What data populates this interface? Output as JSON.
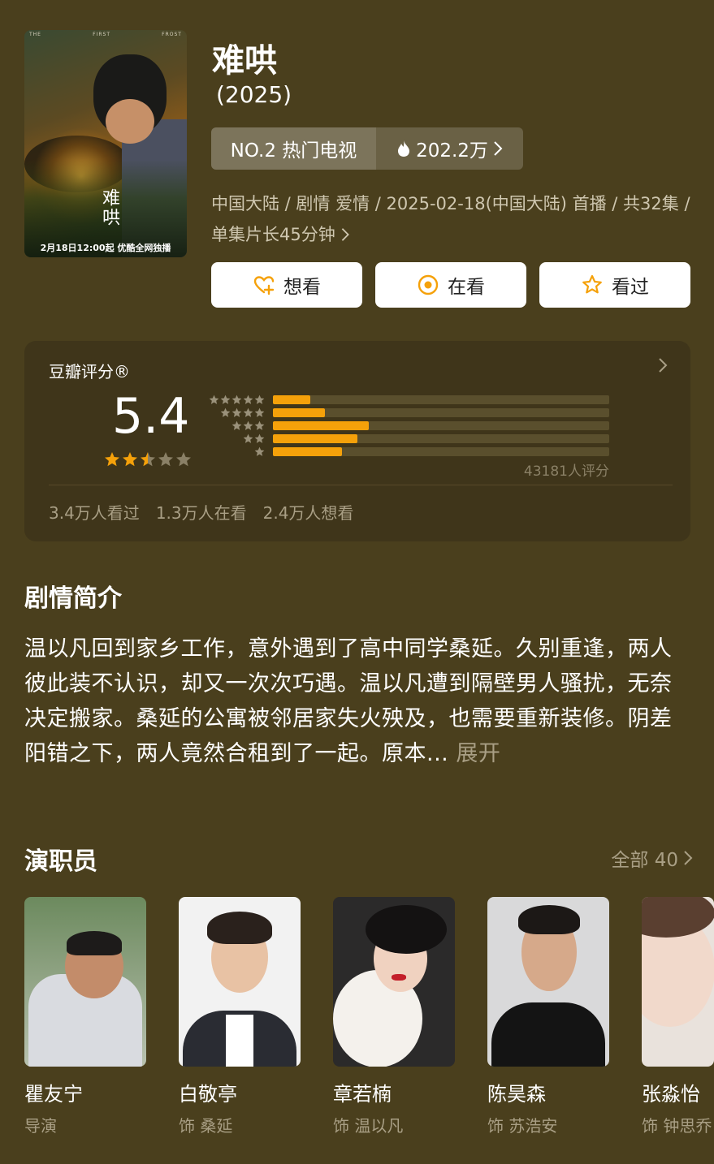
{
  "show": {
    "title": "难哄",
    "year": "(2025)",
    "rank_label": "NO.2 热门电视",
    "heat": "202.2万",
    "meta": "中国大陆 / 剧情 爱情 / 2025-02-18(中国大陆) 首播 / 共32集 / 单集片长45分钟",
    "poster": {
      "title": "难哄",
      "caption": "2月18日12:00起 优酷全网独播",
      "top_left": "THE",
      "top_mid": "FIRST",
      "top_right": "FROST"
    }
  },
  "actions": [
    {
      "label": "想看",
      "icon": "heart-plus-icon"
    },
    {
      "label": "在看",
      "icon": "target-icon"
    },
    {
      "label": "看过",
      "icon": "star-outline-icon"
    }
  ],
  "rating": {
    "label": "豆瓣评分®",
    "score": "5.4",
    "stars": 2.5,
    "distribution": [
      {
        "stars": 5,
        "fraction": 0.11
      },
      {
        "stars": 4,
        "fraction": 0.155
      },
      {
        "stars": 3,
        "fraction": 0.285
      },
      {
        "stars": 2,
        "fraction": 0.25
      },
      {
        "stars": 1,
        "fraction": 0.205
      }
    ],
    "votes": "43181人评分",
    "watched": "3.4万人看过",
    "watching": "1.3万人在看",
    "want": "2.4万人想看",
    "colors": {
      "accent": "#f5a10a",
      "muted": "#8a8066"
    }
  },
  "synopsis": {
    "title": "剧情简介",
    "text": "温以凡回到家乡工作，意外遇到了高中同学桑延。久别重逢，两人彼此装不认识，却又一次次巧遇。温以凡遭到隔壁男人骚扰，无奈决定搬家。桑延的公寓被邻居家失火殃及，也需要重新装修。阴差阳错之下，两人竟然合租到了一起。原本...",
    "expand": "展开"
  },
  "cast": {
    "title": "演职员",
    "all_label": "全部 40",
    "members": [
      {
        "name": "瞿友宁",
        "role": "导演"
      },
      {
        "name": "白敬亭",
        "role": "饰 桑延"
      },
      {
        "name": "章若楠",
        "role": "饰 温以凡"
      },
      {
        "name": "陈昊森",
        "role": "饰 苏浩安"
      },
      {
        "name": "张淼怡",
        "role": "饰 钟思乔"
      }
    ]
  }
}
